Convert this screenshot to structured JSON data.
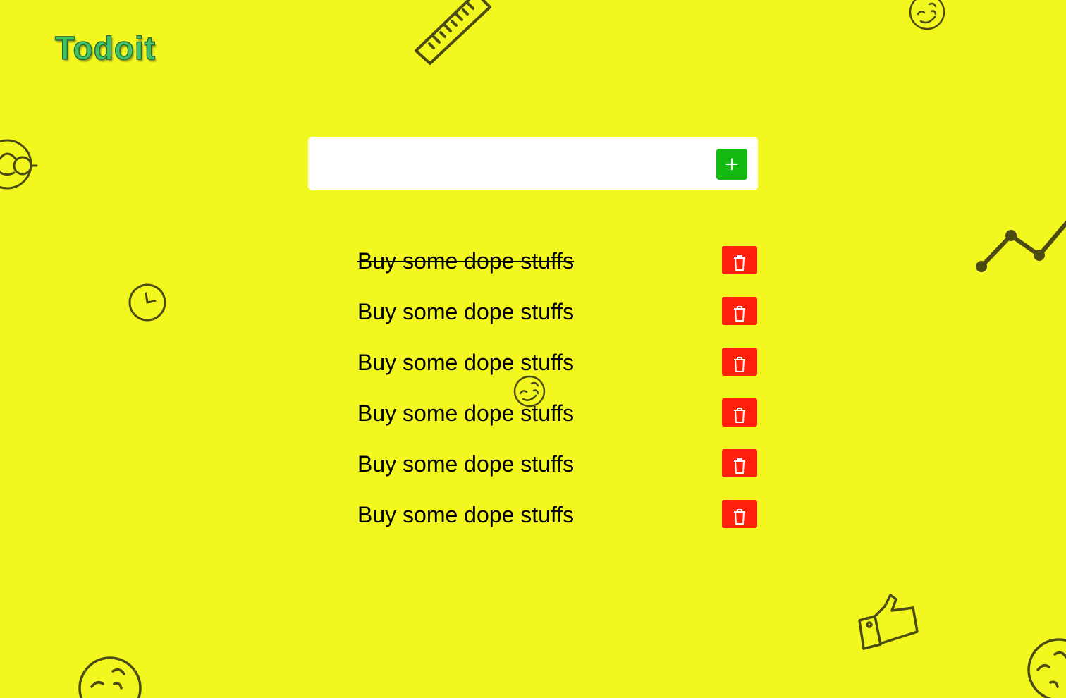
{
  "app": {
    "logo_text": "Todoit"
  },
  "input": {
    "value": "",
    "placeholder": "",
    "add_button_label": "+"
  },
  "todos": [
    {
      "text": "Buy some dope stuffs",
      "done": true
    },
    {
      "text": "Buy some dope stuffs",
      "done": false
    },
    {
      "text": "Buy some dope stuffs",
      "done": false
    },
    {
      "text": "Buy some dope stuffs",
      "done": false
    },
    {
      "text": "Buy some dope stuffs",
      "done": false
    },
    {
      "text": "Buy some dope stuffs",
      "done": false
    }
  ],
  "icons": {
    "add": "plus-icon",
    "delete": "trash-icon"
  },
  "colors": {
    "background": "#f3f720",
    "add_button": "#13b811",
    "delete_button": "#ff1f0a",
    "logo": "#3fc463",
    "doodle_stroke": "#4a4a12"
  }
}
